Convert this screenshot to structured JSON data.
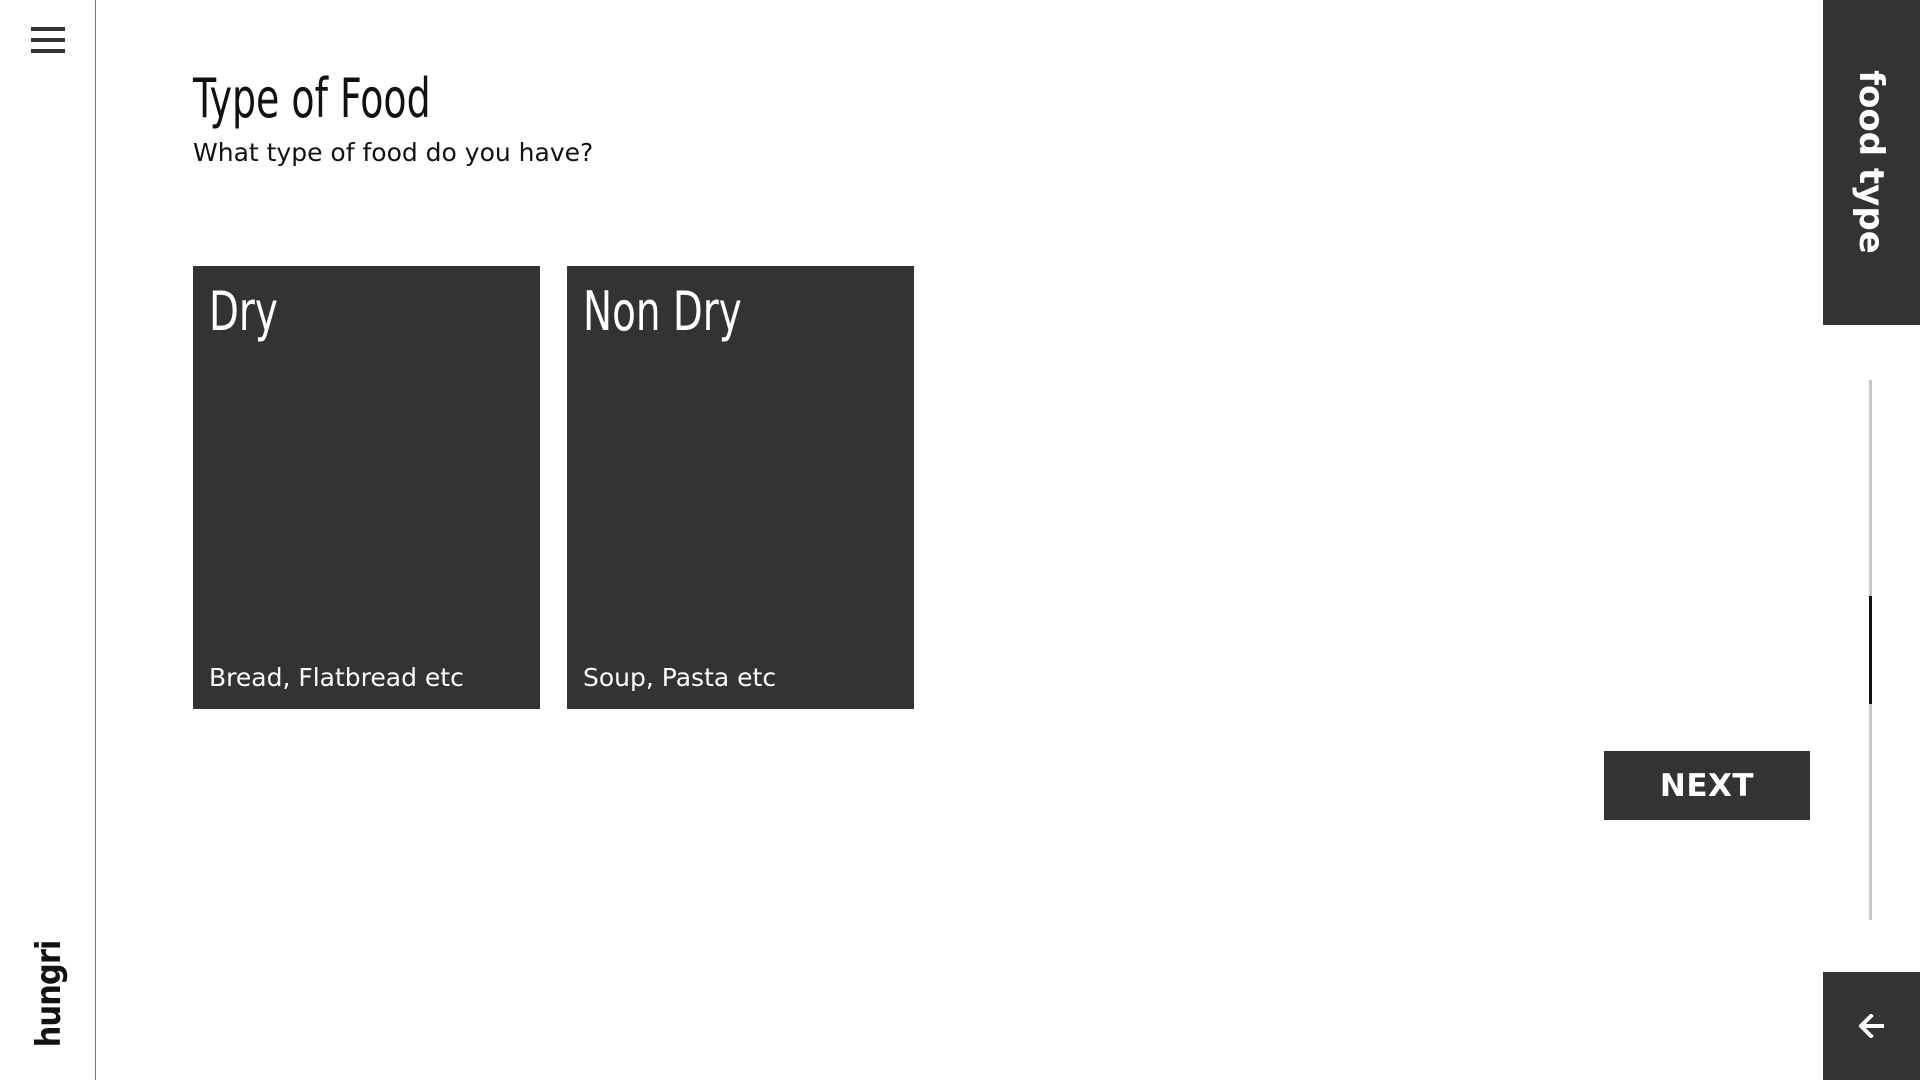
{
  "sidebar": {
    "menu_icon": "hamburger-menu-icon",
    "brand": "hungri"
  },
  "header": {
    "title": "Type of Food",
    "subtitle": "What type of food do you have?"
  },
  "options": [
    {
      "title": "Dry",
      "description": "Bread, Flatbread etc"
    },
    {
      "title": "Non Dry",
      "description": "Soup, Pasta etc"
    }
  ],
  "actions": {
    "next_label": "NEXT",
    "back_icon": "arrow-left-icon"
  },
  "section_tab": {
    "label": "food type"
  },
  "progress": {
    "thumb_start_fraction": 0.4,
    "thumb_length_fraction": 0.2
  },
  "colors": {
    "card_bg": "#333333",
    "page_bg": "#ffffff",
    "text": "#111111",
    "track": "#c8c8c8"
  }
}
